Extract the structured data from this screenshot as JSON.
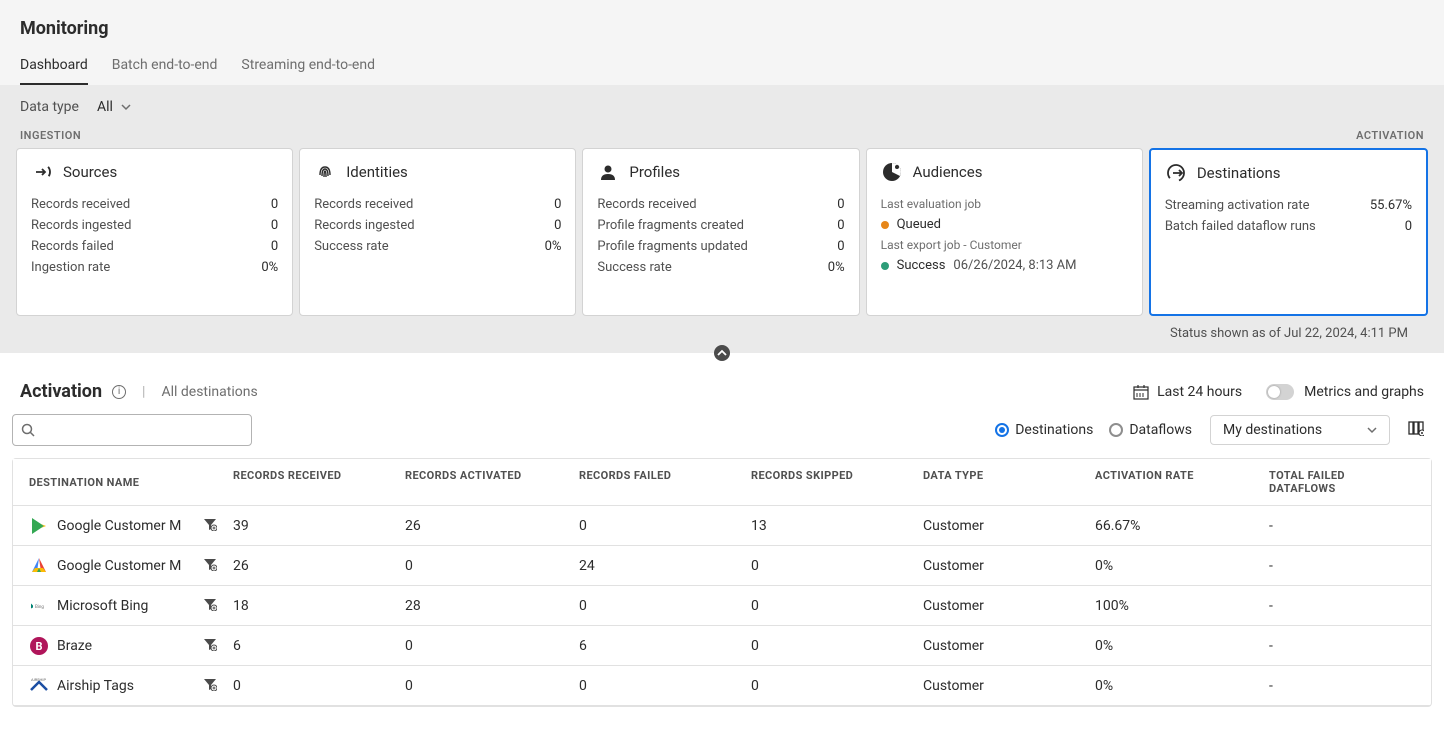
{
  "page": {
    "title": "Monitoring"
  },
  "tabs": [
    {
      "label": "Dashboard",
      "active": true
    },
    {
      "label": "Batch end-to-end",
      "active": false
    },
    {
      "label": "Streaming end-to-end",
      "active": false
    }
  ],
  "filter": {
    "label": "Data type",
    "value": "All"
  },
  "sectionLabels": {
    "left": "INGESTION",
    "right": "ACTIVATION"
  },
  "cards": {
    "sources": {
      "title": "Sources",
      "rows": [
        {
          "label": "Records received",
          "value": "0"
        },
        {
          "label": "Records ingested",
          "value": "0"
        },
        {
          "label": "Records failed",
          "value": "0"
        },
        {
          "label": "Ingestion rate",
          "value": "0%"
        }
      ]
    },
    "identities": {
      "title": "Identities",
      "rows": [
        {
          "label": "Records received",
          "value": "0"
        },
        {
          "label": "Records ingested",
          "value": "0"
        },
        {
          "label": "Success rate",
          "value": "0%"
        }
      ]
    },
    "profiles": {
      "title": "Profiles",
      "rows": [
        {
          "label": "Records received",
          "value": "0"
        },
        {
          "label": "Profile fragments created",
          "value": "0"
        },
        {
          "label": "Profile fragments updated",
          "value": "0"
        },
        {
          "label": "Success rate",
          "value": "0%"
        }
      ]
    },
    "audiences": {
      "title": "Audiences",
      "lastEvalLabel": "Last evaluation job",
      "evalStatus": "Queued",
      "lastExportLabel": "Last export job - Customer",
      "exportStatus": "Success",
      "exportTime": "06/26/2024, 8:13 AM"
    },
    "destinations": {
      "title": "Destinations",
      "rows": [
        {
          "label": "Streaming activation rate",
          "value": "55.67%"
        },
        {
          "label": "Batch failed dataflow runs",
          "value": "0"
        }
      ]
    }
  },
  "statusFooter": "Status shown as of Jul 22, 2024, 4:11 PM",
  "activation": {
    "title": "Activation",
    "subtext": "All destinations",
    "timeRange": "Last 24 hours",
    "toggleLabel": "Metrics and graphs",
    "radios": {
      "destinations": "Destinations",
      "dataflows": "Dataflows"
    },
    "dropdown": "My destinations"
  },
  "table": {
    "headers": {
      "name": "DESTINATION NAME",
      "received": "RECORDS RECEIVED",
      "activated": "RECORDS ACTIVATED",
      "failed": "RECORDS FAILED",
      "skipped": "RECORDS SKIPPED",
      "datatype": "DATA TYPE",
      "rate": "ACTIVATION RATE",
      "totalfailed": "TOTAL FAILED DATAFLOWS"
    },
    "rows": [
      {
        "name": "Google Customer M",
        "logo": "google-play",
        "received": "39",
        "activated": "26",
        "failed": "0",
        "skipped": "13",
        "datatype": "Customer",
        "rate": "66.67%",
        "totalfailed": "-"
      },
      {
        "name": "Google Customer M",
        "logo": "google",
        "received": "26",
        "activated": "0",
        "failed": "24",
        "skipped": "0",
        "datatype": "Customer",
        "rate": "0%",
        "totalfailed": "-"
      },
      {
        "name": "Microsoft Bing",
        "logo": "bing",
        "received": "18",
        "activated": "28",
        "failed": "0",
        "skipped": "0",
        "datatype": "Customer",
        "rate": "100%",
        "totalfailed": "-"
      },
      {
        "name": "Braze",
        "logo": "braze",
        "received": "6",
        "activated": "0",
        "failed": "6",
        "skipped": "0",
        "datatype": "Customer",
        "rate": "0%",
        "totalfailed": "-"
      },
      {
        "name": "Airship Tags",
        "logo": "airship",
        "received": "0",
        "activated": "0",
        "failed": "0",
        "skipped": "0",
        "datatype": "Customer",
        "rate": "0%",
        "totalfailed": "-"
      }
    ]
  }
}
